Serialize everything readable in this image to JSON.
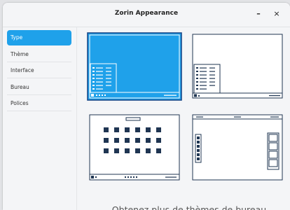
{
  "window": {
    "title": "Zorin Appearance",
    "minimize_label": "–",
    "close_label": "×"
  },
  "sidebar": {
    "items": [
      {
        "label": "Type",
        "active": true
      },
      {
        "label": "Thème",
        "active": false
      },
      {
        "label": "Interface",
        "active": false
      },
      {
        "label": "Bureau",
        "active": false
      },
      {
        "label": "Polices",
        "active": false
      }
    ]
  },
  "layouts": [
    {
      "name": "layout-windows-like",
      "selected": true
    },
    {
      "name": "layout-classic",
      "selected": false
    },
    {
      "name": "layout-app-grid",
      "selected": false
    },
    {
      "name": "layout-top-panel",
      "selected": false
    }
  ],
  "footer": {
    "text": "Obtenez plus de thèmes de bureau"
  },
  "colors": {
    "accent": "#1fa1ea",
    "outline": "#1f3552",
    "selected_outline": "#1a4a8a"
  }
}
